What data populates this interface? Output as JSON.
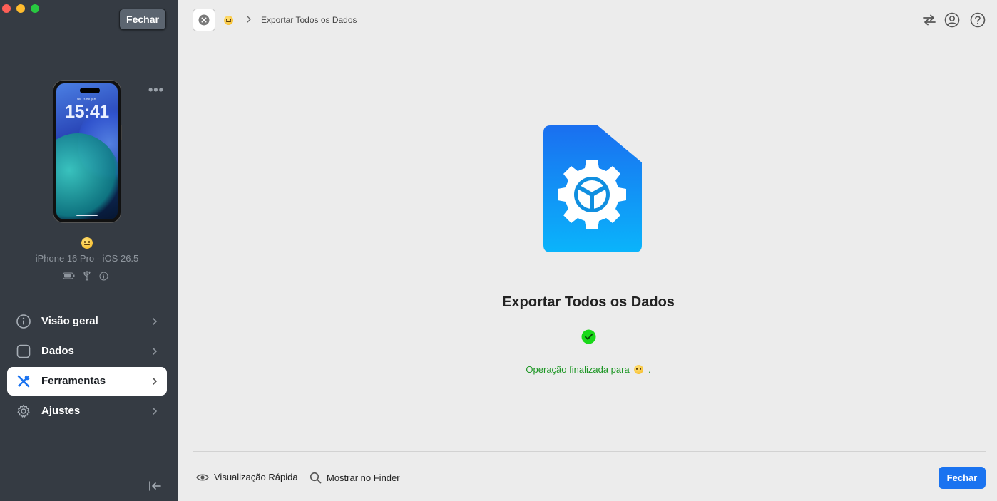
{
  "window": {
    "close_label": "Fechar"
  },
  "device": {
    "lockscreen_date": "ter. 3 de jan.",
    "lockscreen_time": "15:41",
    "more": "•••",
    "name": "iPhone 16 Pro - iOS 26.5"
  },
  "sidebar": {
    "items": [
      {
        "label": "Visão geral",
        "icon": "info-icon"
      },
      {
        "label": "Dados",
        "icon": "square-icon"
      },
      {
        "label": "Ferramentas",
        "icon": "tools-icon",
        "active": true
      },
      {
        "label": "Ajustes",
        "icon": "gear-icon"
      }
    ]
  },
  "breadcrumb": {
    "current": "Exportar Todos os Dados"
  },
  "main": {
    "title": "Exportar Todos os Dados",
    "status_prefix": "Operação finalizada para",
    "status_suffix": "."
  },
  "footer": {
    "quick_look": "Visualização Rápida",
    "show_in_finder": "Mostrar no Finder",
    "close_button": "Fechar"
  },
  "colors": {
    "sidebar_bg": "#353b43",
    "accent": "#1a73f0",
    "success": "#1d9624"
  }
}
